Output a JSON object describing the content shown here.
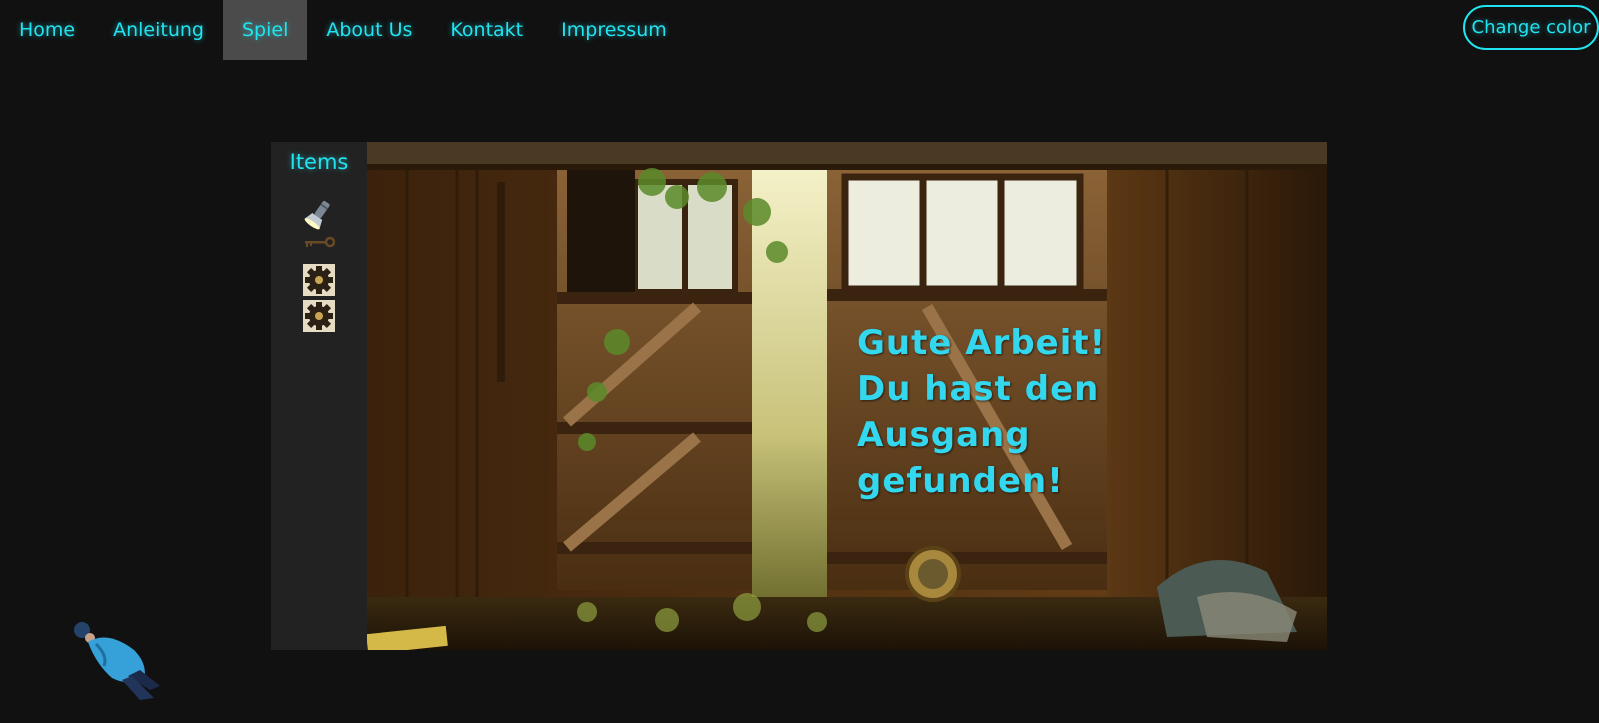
{
  "nav": {
    "items": [
      {
        "label": "Home",
        "active": false
      },
      {
        "label": "Anleitung",
        "active": false
      },
      {
        "label": "Spiel",
        "active": true
      },
      {
        "label": "About Us",
        "active": false
      },
      {
        "label": "Kontakt",
        "active": false
      },
      {
        "label": "Impressum",
        "active": false
      }
    ],
    "change_color_label": "Change color"
  },
  "inventory": {
    "title": "Items",
    "items": [
      {
        "icon": "flashlight-icon"
      },
      {
        "icon": "key-icon"
      },
      {
        "icon": "gear-icon"
      },
      {
        "icon": "gear-icon"
      }
    ]
  },
  "scene": {
    "message_lines": [
      "Gute Arbeit!",
      "Du hast den",
      "Ausgang",
      "gefunden!"
    ]
  },
  "colors": {
    "accent": "#22e4f0",
    "background": "#111111",
    "panel": "#222222",
    "active_tab": "#4b4b4b"
  }
}
